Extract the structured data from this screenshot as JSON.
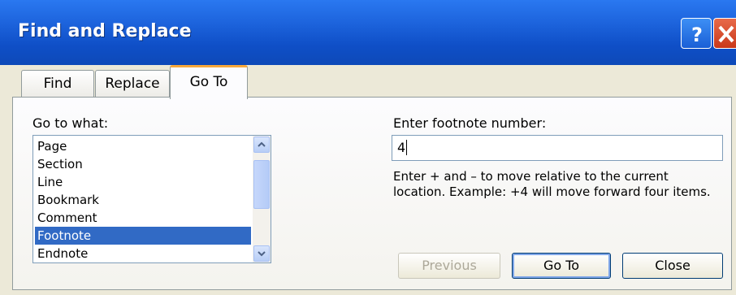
{
  "window": {
    "title": "Find and Replace",
    "help_icon": "help-icon",
    "close_icon": "close-icon"
  },
  "tabs": [
    {
      "label": "Find",
      "selected": false
    },
    {
      "label": "Replace",
      "selected": false
    },
    {
      "label": "Go To",
      "selected": true
    }
  ],
  "goto": {
    "list_label": "Go to what:",
    "items": [
      "Page",
      "Section",
      "Line",
      "Bookmark",
      "Comment",
      "Footnote",
      "Endnote"
    ],
    "selected_item": "Footnote",
    "input_label": "Enter footnote number:",
    "input_value": "4",
    "help_text": "Enter + and – to move relative to the current location. Example: +4 will move forward four items."
  },
  "buttons": {
    "previous": "Previous",
    "goto": "Go To",
    "close": "Close"
  },
  "colors": {
    "titlebar": "#0f4fc7",
    "selection": "#316ac5",
    "active_tab_accent": "#f7a83a"
  }
}
